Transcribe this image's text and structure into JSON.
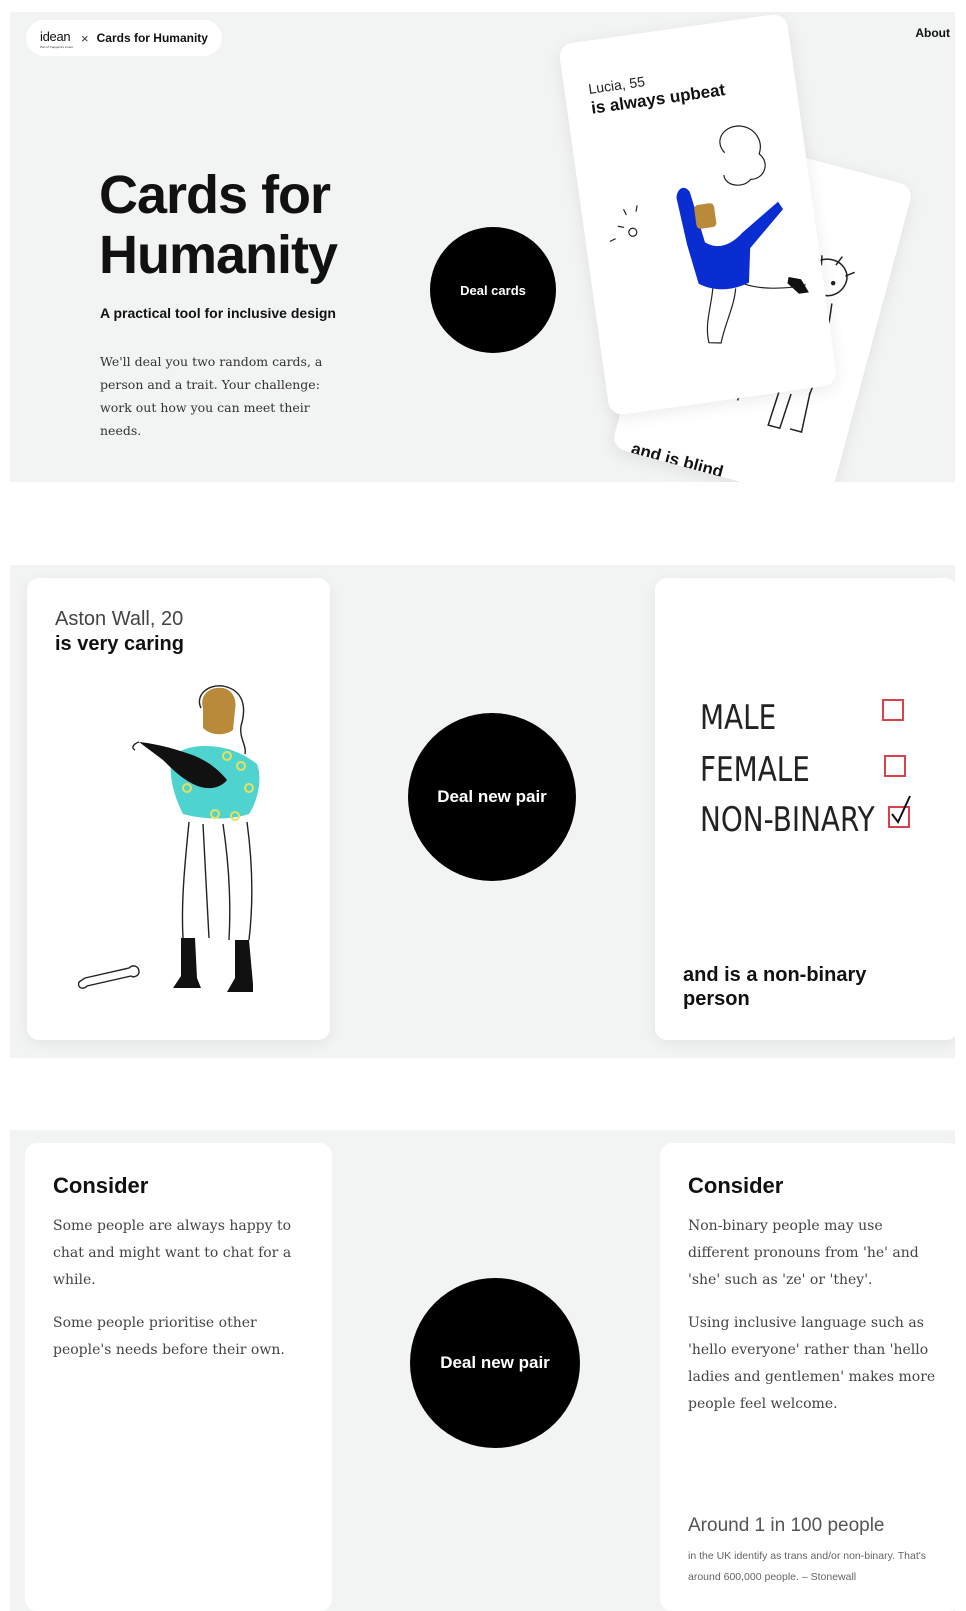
{
  "header": {
    "brand": "idean",
    "brand_sub": "Part of Capgemini Invent",
    "times": "×",
    "site": "Cards for Humanity",
    "about": "About"
  },
  "hero": {
    "title": "Cards for Humanity",
    "subtitle": "A practical tool for inclusive design",
    "body": "We'll deal you two random cards, a person and a trait. Your challenge: work out how you can meet their needs.",
    "deal_button": "Deal cards",
    "front_card": {
      "name": "Lucia, 55",
      "trait": "is always upbeat"
    },
    "back_card": {
      "trait": "and is blind"
    }
  },
  "pair": {
    "person_card": {
      "name": "Aston Wall, 20",
      "trait": "is very caring"
    },
    "deal_button": "Deal new pair",
    "trait_card": {
      "options": [
        "MALE",
        "FEMALE",
        "NON-BINARY"
      ],
      "trait": "and is a non-binary person"
    }
  },
  "consider": {
    "left": {
      "title": "Consider",
      "paragraphs": [
        "Some people are always happy to chat and might want to chat for a while.",
        "Some people prioritise other people's needs before their own."
      ]
    },
    "deal_button": "Deal new pair",
    "right": {
      "title": "Consider",
      "paragraphs": [
        "Non-binary people may use different pronouns from 'he' and 'she' such as 'ze' or 'they'.",
        "Using inclusive language such as 'hello everyone' rather than 'hello ladies and gentlemen' makes more people feel welcome."
      ],
      "stat": "Around 1 in 100 people",
      "stat_detail": "in the UK identify as trans and/or non-binary. That's around 600,000 people. – Stonewall"
    }
  },
  "colors": {
    "panel": "#f2f3f3",
    "button": "#000000",
    "checkbox": "#d9424a",
    "sweater_blue": "#0a2dd1",
    "sweater_teal": "#4fd3cf",
    "skin": "#b98a3a",
    "dog_shirt": "#e29ad0"
  }
}
